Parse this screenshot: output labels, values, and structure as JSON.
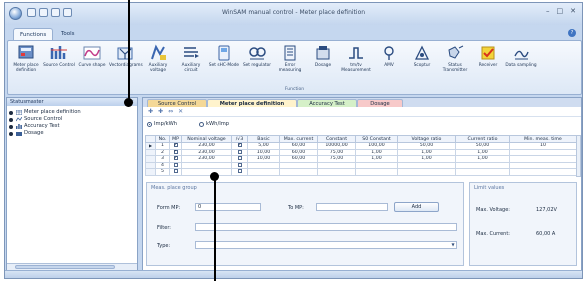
{
  "window": {
    "title": "WinSAM manual control - Meter place definition"
  },
  "ribbon_tabs": [
    {
      "label": "Functions",
      "active": true
    },
    {
      "label": "Tools",
      "active": false
    }
  ],
  "ribbon": {
    "buttons": [
      {
        "label": "Meter place definition",
        "icon": "meter-place-icon"
      },
      {
        "label": "Source Control",
        "icon": "source-control-icon"
      },
      {
        "label": "Curve shape",
        "icon": "curve-shape-icon"
      },
      {
        "label": "Vectordiagrams",
        "icon": "vector-diagram-icon"
      },
      {
        "label": "Auxiliary voltage",
        "icon": "aux-voltage-icon"
      },
      {
        "label": "Auxiliary circuit",
        "icon": "aux-circuit-icon"
      },
      {
        "label": "Set sHC-Mode",
        "icon": "set-mode-icon"
      },
      {
        "label": "Set regulator",
        "icon": "regulator-icon"
      },
      {
        "label": "Error measuring",
        "icon": "error-measuring-icon"
      },
      {
        "label": "Dosage",
        "icon": "dosage-icon"
      },
      {
        "label": "tm/tv Measurement",
        "icon": "measurement-icon"
      },
      {
        "label": "AMV",
        "icon": "amv-icon"
      },
      {
        "label": "Scoptur",
        "icon": "scope-icon"
      },
      {
        "label": "Status Transmitter",
        "icon": "status-transmitter-icon"
      },
      {
        "label": "Receiver",
        "icon": "receiver-icon"
      },
      {
        "label": "Data sampling",
        "icon": "data-sampling-icon"
      }
    ],
    "group_label": "Function"
  },
  "side_panel": {
    "title": "Statusmaster",
    "items": [
      {
        "label": "Meter place definition",
        "icon": "table-icon"
      },
      {
        "label": "Source Control",
        "icon": "source-icon"
      },
      {
        "label": "Accuracy Test",
        "icon": "bars-icon"
      },
      {
        "label": "Dosage",
        "icon": "dosage-icon"
      }
    ]
  },
  "doc_tabs": [
    {
      "label": "Source Control"
    },
    {
      "label": "Meter place definition"
    },
    {
      "label": "Accuracy Test"
    },
    {
      "label": "Dosage"
    }
  ],
  "radios": [
    {
      "label": "Imp/kWh",
      "checked": true
    },
    {
      "label": "kWh/Imp",
      "checked": false
    }
  ],
  "table": {
    "columns": [
      "",
      "No.",
      "MP",
      "Nominal voltage",
      "/√3",
      "Basic",
      "Max. current",
      "Constant",
      "S0 Constant",
      "Voltage ratio",
      "Current ratio",
      "Min. meas. time"
    ],
    "rows": [
      {
        "marker": "▶",
        "no": "1",
        "mp": true,
        "voltage": "230,00",
        "sqrt3": true,
        "basic": "5,00",
        "max": "60,00",
        "constant": "10000,00",
        "s0": "100,00",
        "vratio": "50,00",
        "cratio": "50,00",
        "mintime": "10"
      },
      {
        "marker": "",
        "no": "2",
        "mp": true,
        "voltage": "230,00",
        "sqrt3": false,
        "basic": "10,00",
        "max": "60,00",
        "constant": "75,00",
        "s0": "1,00",
        "vratio": "1,00",
        "cratio": "1,00",
        "mintime": ""
      },
      {
        "marker": "",
        "no": "3",
        "mp": true,
        "voltage": "230,00",
        "sqrt3": false,
        "basic": "10,00",
        "max": "60,00",
        "constant": "75,00",
        "s0": "1,00",
        "vratio": "1,00",
        "cratio": "1,00",
        "mintime": ""
      },
      {
        "marker": "",
        "no": "4",
        "mp": false,
        "voltage": "",
        "sqrt3": false,
        "basic": "",
        "max": "",
        "constant": "",
        "s0": "",
        "vratio": "",
        "cratio": "",
        "mintime": ""
      },
      {
        "marker": "",
        "no": "5",
        "mp": false,
        "voltage": "",
        "sqrt3": false,
        "basic": "",
        "max": "",
        "constant": "",
        "s0": "",
        "vratio": "",
        "cratio": "",
        "mintime": ""
      }
    ]
  },
  "meas_group": {
    "title": "Meas. place group",
    "from_label": "Form MP:",
    "from_value": "0",
    "to_label": "To MP:",
    "to_value": "",
    "add_label": "Add",
    "filter_label": "Filter:",
    "filter_value": "",
    "type_label": "Type:",
    "type_value": ""
  },
  "limits": {
    "title": "Limit values",
    "max_voltage_label": "Max. Voltage:",
    "max_voltage_value": "127,02V",
    "max_current_label": "Max. Current:",
    "max_current_value": "60,00 A"
  },
  "colors": {
    "accent": "#3f74c2",
    "frame": "#c5d7ef",
    "tab_source": "#f4d897",
    "tab_meter": "#fff3cc",
    "tab_accuracy": "#d5f0c8",
    "tab_dosage": "#f7c9c9"
  }
}
